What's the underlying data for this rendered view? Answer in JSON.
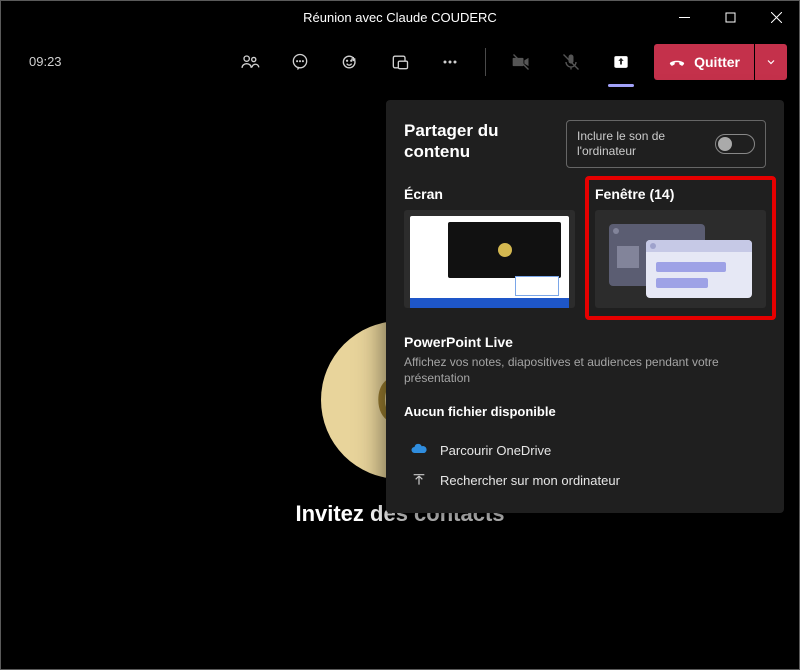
{
  "window": {
    "title": "Réunion avec Claude COUDERC"
  },
  "toolbar": {
    "time": "09:23",
    "quit_label": "Quitter"
  },
  "stage": {
    "avatar_initial": "C",
    "invite_text": "Invitez des contacts"
  },
  "share_panel": {
    "title": "Partager du contenu",
    "sound_label": "Inclure le son de l'ordinateur",
    "screen_label": "Écran",
    "window_label": "Fenêtre (14)",
    "powerpoint_title": "PowerPoint Live",
    "powerpoint_desc": "Affichez vos notes, diapositives et audiences pendant votre présentation",
    "no_file": "Aucun fichier disponible",
    "browse_onedrive": "Parcourir OneDrive",
    "browse_computer": "Rechercher sur mon ordinateur"
  }
}
